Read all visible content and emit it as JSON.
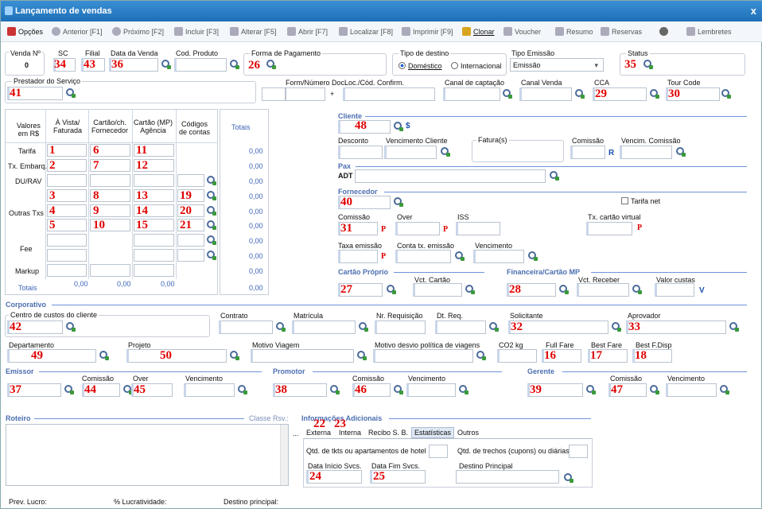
{
  "window": {
    "title": "Lançamento de vendas",
    "close": "x"
  },
  "toolbar": [
    {
      "label": "Opções"
    },
    {
      "label": "Anterior [F1]"
    },
    {
      "label": "Próximo [F2]"
    },
    {
      "label": "Incluir [F3]"
    },
    {
      "label": "Alterar [F5]"
    },
    {
      "label": "Abrir [F7]"
    },
    {
      "label": "Localizar [F8]"
    },
    {
      "label": "Imprimir [F9]"
    },
    {
      "label": "Clonar"
    },
    {
      "label": "Voucher"
    },
    {
      "label": "Resumo"
    },
    {
      "label": "Reservas"
    },
    {
      "label": ""
    },
    {
      "label": "Lembretes"
    }
  ],
  "header": {
    "venda_label": "Venda Nº",
    "venda_value": "0",
    "sc_label": "SC",
    "sc_num": "34",
    "filial_label": "Filial",
    "filial_num": "43",
    "data_venda_label": "Data da Venda",
    "data_venda_num": "36",
    "cod_produto_label": "Cod. Produto",
    "forma_pag_label": "Forma de Pagamento",
    "forma_pag_num": "26",
    "tipo_destino_label": "Tipo de destino",
    "domestico": "Doméstico",
    "internacional": "Internacional",
    "tipo_emissao_label": "Tipo Emissão",
    "tipo_emissao_value": "Emissão",
    "status_label": "Status",
    "status_num": "35"
  },
  "row2": {
    "prestador_label": "Prestador do Serviço",
    "prestador_num": "41",
    "form_label": "Form/Número Doc.",
    "plus": "+",
    "loc_label": "Loc./Cód. Confirm.",
    "canal_captacao": "Canal de captação",
    "canal_venda": "Canal Venda",
    "cca_label": "CCA",
    "cca_num": "29",
    "tour_label": "Tour Code",
    "tour_num": "30"
  },
  "grid": {
    "valores": "Valores\nem R$",
    "vista": "À Vista/\nFaturada",
    "cartao_forn": "Cartão/ch.\nFornecedor",
    "cartao_mp": "Cartão (MP)\nAgência",
    "codigos": "Códigos\nde contas",
    "totais": "Totais",
    "rows": [
      "Tarifa",
      "Tx. Embarq.",
      "DU/RAV",
      "Outras Txs",
      "Fee",
      "Markup"
    ],
    "totais_row": "Totais",
    "zero": "0,00",
    "nums": {
      "r1": [
        "1",
        "6",
        "11"
      ],
      "r2": [
        "2",
        "7",
        "12"
      ],
      "r3": [
        "3",
        "8",
        "13",
        "19"
      ],
      "r4": [
        "4",
        "9",
        "14",
        "20"
      ],
      "r5": [
        "5",
        "10",
        "15",
        "21"
      ]
    }
  },
  "cliente": {
    "title": "Cliente",
    "num": "48",
    "desconto": "Desconto",
    "venc_cliente": "Vencimento Cliente",
    "faturas": "Fatura(s)",
    "comissao": "Comissão",
    "venc_comissao": "Vencim. Comissão",
    "R": "R",
    "dollar": "$"
  },
  "pax": {
    "title": "Pax",
    "adt": "ADT"
  },
  "fornecedor": {
    "title": "Fornecedor",
    "num": "40",
    "tarifa_net": "Tarifa net",
    "comissao": "Comissão",
    "comissao_num": "31",
    "over": "Over",
    "iss": "ISS",
    "tx_cartao": "Tx. cartão virtual",
    "taxa_emissao": "Taxa emissão",
    "conta_tx": "Conta tx. emissão",
    "vencimento": "Vencimento",
    "P": "P"
  },
  "cartao": {
    "title": "Cartão Próprio",
    "num": "27",
    "vct": "Vct. Cartão"
  },
  "financeira": {
    "title": "Financeira/Cartão MP",
    "num": "28",
    "vct_receber": "Vct. Receber",
    "valor_custas": "Valor custas",
    "V": "V"
  },
  "corporativo": {
    "title": "Corporativo",
    "centro": "Centro de custos do cliente",
    "centro_num": "42",
    "contrato": "Contrato",
    "matricula": "Matrícula",
    "nr_req": "Nr. Requisição",
    "dt_req": "Dt. Req.",
    "solicitante": "Solicitante",
    "solicitante_num": "32",
    "aprovador": "Aprovador",
    "aprovador_num": "33",
    "departamento": "Departamento",
    "departamento_num": "49",
    "projeto": "Projeto",
    "projeto_num": "50",
    "motivo": "Motivo Viagem",
    "motivo_desvio": "Motivo desvio política de viagens",
    "co2": "CO2 kg",
    "full_fare": "Full Fare",
    "full_num": "16",
    "best_fare": "Best Fare",
    "best_num": "17",
    "best_disp": "Best F.Disp",
    "best_disp_num": "18"
  },
  "emissor": {
    "title": "Emissor",
    "num": "37",
    "comissao": "Comissão",
    "comissao_num": "44",
    "over": "Over",
    "over_num": "45",
    "vencimento": "Vencimento"
  },
  "promotor": {
    "title": "Promotor",
    "num": "38",
    "comissao": "Comissão",
    "comissao_num": "46",
    "vencimento": "Vencimento"
  },
  "gerente": {
    "title": "Gerente",
    "num": "39",
    "comissao": "Comissão",
    "comissao_num": "47",
    "vencimento": "Vencimento"
  },
  "roteiro": {
    "title": "Roteiro",
    "classe": "Classe Rsv.:"
  },
  "info": {
    "title": "Informações Adicionais",
    "dots": "...",
    "tabs": [
      "Externa",
      "Interna",
      "Recibo S. B.",
      "Estatísticas",
      "Outros"
    ],
    "tab_nums": [
      "22",
      "23"
    ],
    "qtd_tkts": "Qtd. de tkts ou apartamentos de hotel",
    "qtd_trechos": "Qtd. de trechos (cupons) ou diárias",
    "data_inicio": "Data Início Svcs.",
    "data_inicio_num": "24",
    "data_fim": "Data Fim Svcs.",
    "data_fim_num": "25",
    "destino": "Destino Principal"
  },
  "footer": {
    "prev_lucro": "Prev. Lucro:",
    "lucratividade": "% Lucratividade:",
    "destino": "Destino principal:"
  }
}
